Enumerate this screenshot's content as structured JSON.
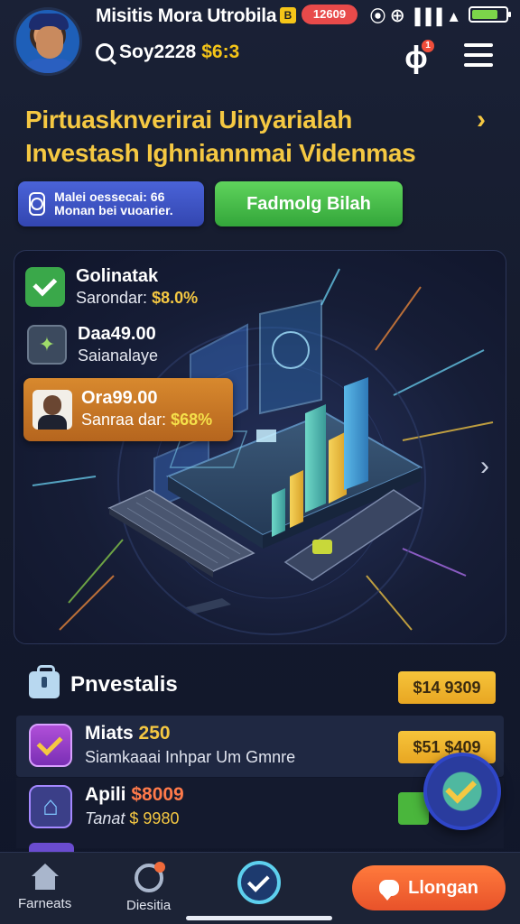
{
  "status_bar": {
    "title": "Misitis Mora Utrobila",
    "badge": "B",
    "pill": "12609",
    "icons": [
      "alarm-icon",
      "wifi-icon",
      "signal-icon",
      "battery-icon"
    ],
    "sys_text": "⦿ ⊕ ▐▐▐ ▲"
  },
  "header": {
    "search_text": "Soy2228",
    "search_amount": "$6:3",
    "bell_badge": "1"
  },
  "headline": {
    "line1": "Pirtuasknverirai Uinyarialah",
    "line2": "Investash Ighniannmai Videnmas",
    "chevron": "›"
  },
  "actions": {
    "blue_button": "Malei oessecai: 66 Monan bei vuoarier.",
    "green_button": "Fadmolg Bilah"
  },
  "hero": {
    "stats": [
      {
        "title": "Golinatak",
        "label": "Sarondar:",
        "value": "$8.0%"
      },
      {
        "title": "Daa49.00",
        "label": "Saianalaye",
        "value": ""
      },
      {
        "title": "Ora99.00",
        "label": "Sanraa dar:",
        "value": "$68%"
      }
    ],
    "next": "›"
  },
  "section": {
    "title": "Pnvestalis",
    "pill": "$14 9309",
    "rows": [
      {
        "title": "Miats",
        "title_value": "250",
        "subtitle": "Siamkaaai Inhpar Um Gmnre",
        "pill": "$51 $409"
      },
      {
        "title": "Apili",
        "title_value": "$8009",
        "subtitle_label": "Tanat",
        "subtitle_value": "$ 9980"
      }
    ]
  },
  "bottom_nav": {
    "items": [
      {
        "label": "Farneats",
        "icon": "home-icon"
      },
      {
        "label": "Diesitia",
        "icon": "discover-icon"
      }
    ],
    "center_icon": "check-circle-icon",
    "cta_label": "Llongan"
  },
  "colors": {
    "accent_yellow": "#f5c842",
    "accent_green": "#4ab63c",
    "accent_orange": "#e8522a",
    "background": "#151b2d"
  }
}
